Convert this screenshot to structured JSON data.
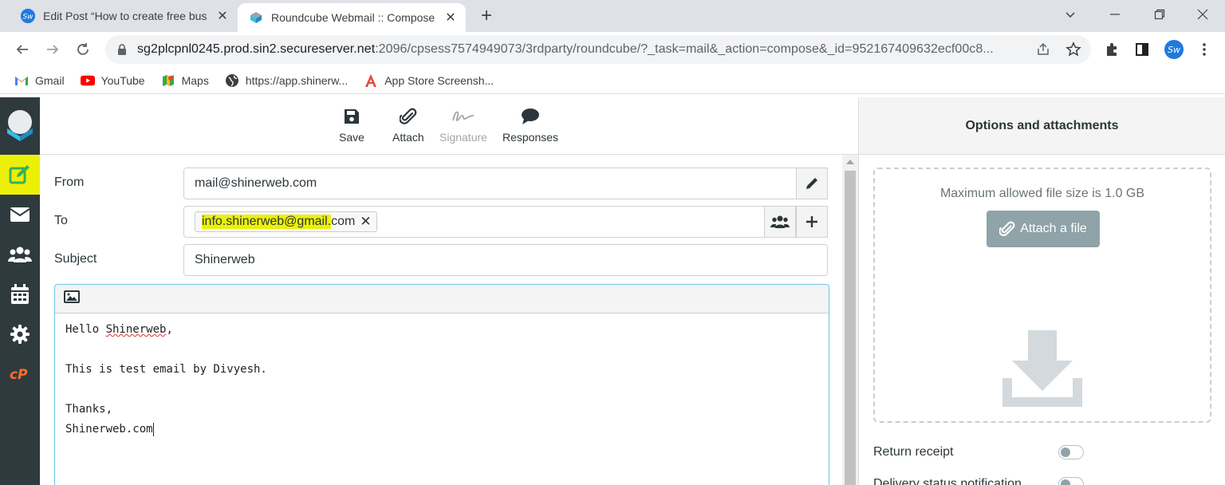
{
  "browser": {
    "tabs": [
      {
        "title": "Edit Post “How to create free bus",
        "active": false
      },
      {
        "title": "Roundcube Webmail :: Compose",
        "active": true
      }
    ],
    "url_host": "sg2plcpnl0245.prod.sin2.secureserver.net",
    "url_rest": ":2096/cpsess7574949073/3rdparty/roundcube/?_task=mail&_action=compose&_id=952167409632ecf00c8...",
    "bookmarks": [
      {
        "label": "Gmail",
        "icon": "gmail-icon"
      },
      {
        "label": "YouTube",
        "icon": "youtube-icon"
      },
      {
        "label": "Maps",
        "icon": "maps-icon"
      },
      {
        "label": "https://app.shinerw...",
        "icon": "globe-icon"
      },
      {
        "label": "App Store Screensh...",
        "icon": "appstore-icon"
      }
    ],
    "profile_initials": "Sw"
  },
  "toolbar": {
    "save_label": "Save",
    "attach_label": "Attach",
    "signature_label": "Signature",
    "responses_label": "Responses"
  },
  "compose": {
    "from_label": "From",
    "from_value": "mail@shinerweb.com",
    "to_label": "To",
    "to_recipient_highlight": "info.shinerweb@gmail.",
    "to_recipient_rest": "com",
    "subject_label": "Subject",
    "subject_value": "Shinerweb",
    "body": {
      "line1_pre": "Hello ",
      "line1_word": "Shinerweb",
      "line1_post": ",",
      "line2": "This is test email by Divyesh.",
      "line3": "Thanks,",
      "line4": "Shinerweb.com"
    }
  },
  "sidebar": {
    "title": "Options and attachments",
    "max_size_text": "Maximum allowed file size is 1.0 GB",
    "attach_file_label": "Attach a file",
    "options": [
      {
        "label": "Return receipt",
        "enabled": false
      },
      {
        "label": "Delivery status notification",
        "enabled": false
      }
    ]
  },
  "colors": {
    "highlight": "#ecf009",
    "rail_bg": "#2f3a3f",
    "attach_button": "#8fa3a9",
    "editor_border": "#6fc3e8"
  }
}
